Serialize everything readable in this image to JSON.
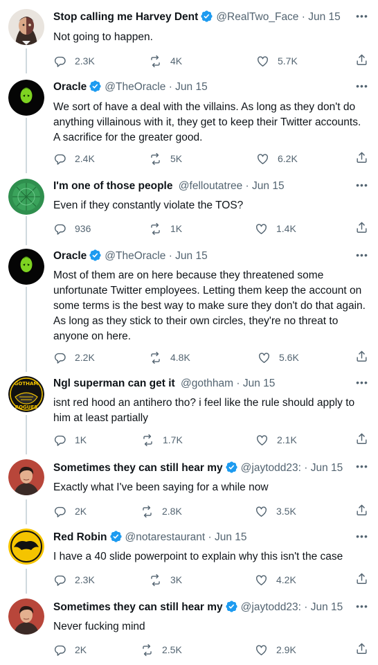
{
  "colors": {
    "verified": "#1d9bf0",
    "text": "#0f1419",
    "secondary": "#536471",
    "thread_line": "#cfd9de"
  },
  "icons": {
    "reply": "reply-icon",
    "retweet": "retweet-icon",
    "like": "like-icon",
    "share": "share-icon",
    "more": "more-options-icon",
    "verified": "verified-badge-icon"
  },
  "tweets": [
    {
      "name": "Stop calling me Harvey Dent",
      "verified": true,
      "handle": "@RealTwo_Face",
      "dot": "·",
      "date": "Jun 15",
      "more": "•••",
      "text": "Not going to happen.",
      "replies": "2.3K",
      "retweets": "4K",
      "likes": "5.7K"
    },
    {
      "name": "Oracle",
      "verified": true,
      "handle": "@TheOracle",
      "dot": "·",
      "date": "Jun 15",
      "more": "•••",
      "text": "We sort of have a deal with the villains. As long as they don't do anything villainous with it, they get to keep their Twitter accounts. A sacrifice for the greater good.",
      "replies": "2.4K",
      "retweets": "5K",
      "likes": "6.2K"
    },
    {
      "name": "I'm one of those people",
      "verified": false,
      "handle": "@felloutatree",
      "dot": "·",
      "date": "Jun 15",
      "more": "•••",
      "text": "Even if they constantly violate the TOS?",
      "replies": "936",
      "retweets": "1K",
      "likes": "1.4K"
    },
    {
      "name": "Oracle",
      "verified": true,
      "handle": "@TheOracle",
      "dot": "·",
      "date": "Jun 15",
      "more": "•••",
      "text": "Most of them are on here because they threatened some unfortunate Twitter employees. Letting them keep the account on some terms is the best way to make sure they don't do that again. As long as they stick to their own circles, they're no threat to anyone on here.",
      "replies": "2.2K",
      "retweets": "4.8K",
      "likes": "5.6K"
    },
    {
      "name": "Ngl superman can get it",
      "verified": false,
      "handle": "@gothham",
      "dot": "·",
      "date": "Jun 15",
      "more": "•••",
      "text": "isnt red hood an antihero tho? i feel like the rule should apply to him at least partially",
      "replies": "1K",
      "retweets": "1.7K",
      "likes": "2.1K",
      "avatar_text_top": "GOTHAM",
      "avatar_text_bottom": "ROGUES"
    },
    {
      "name": "Sometimes they can still hear my",
      "verified": true,
      "handle": "@jaytodd23:",
      "dot": "·",
      "date": "Jun 15",
      "more": "•••",
      "text": "Exactly what I've been saying for a while now",
      "replies": "2K",
      "retweets": "2.8K",
      "likes": "3.5K"
    },
    {
      "name": "Red Robin",
      "verified": true,
      "handle": "@notarestaurant",
      "dot": "·",
      "date": "Jun 15",
      "more": "•••",
      "text": "I have a 40 slide powerpoint to explain why this isn't the case",
      "replies": "2.3K",
      "retweets": "3K",
      "likes": "4.2K"
    },
    {
      "name": "Sometimes they can still hear my",
      "verified": true,
      "handle": "@jaytodd23:",
      "dot": "·",
      "date": "Jun 15",
      "more": "•••",
      "text": "Never fucking mind",
      "replies": "2K",
      "retweets": "2.5K",
      "likes": "2.9K"
    }
  ]
}
